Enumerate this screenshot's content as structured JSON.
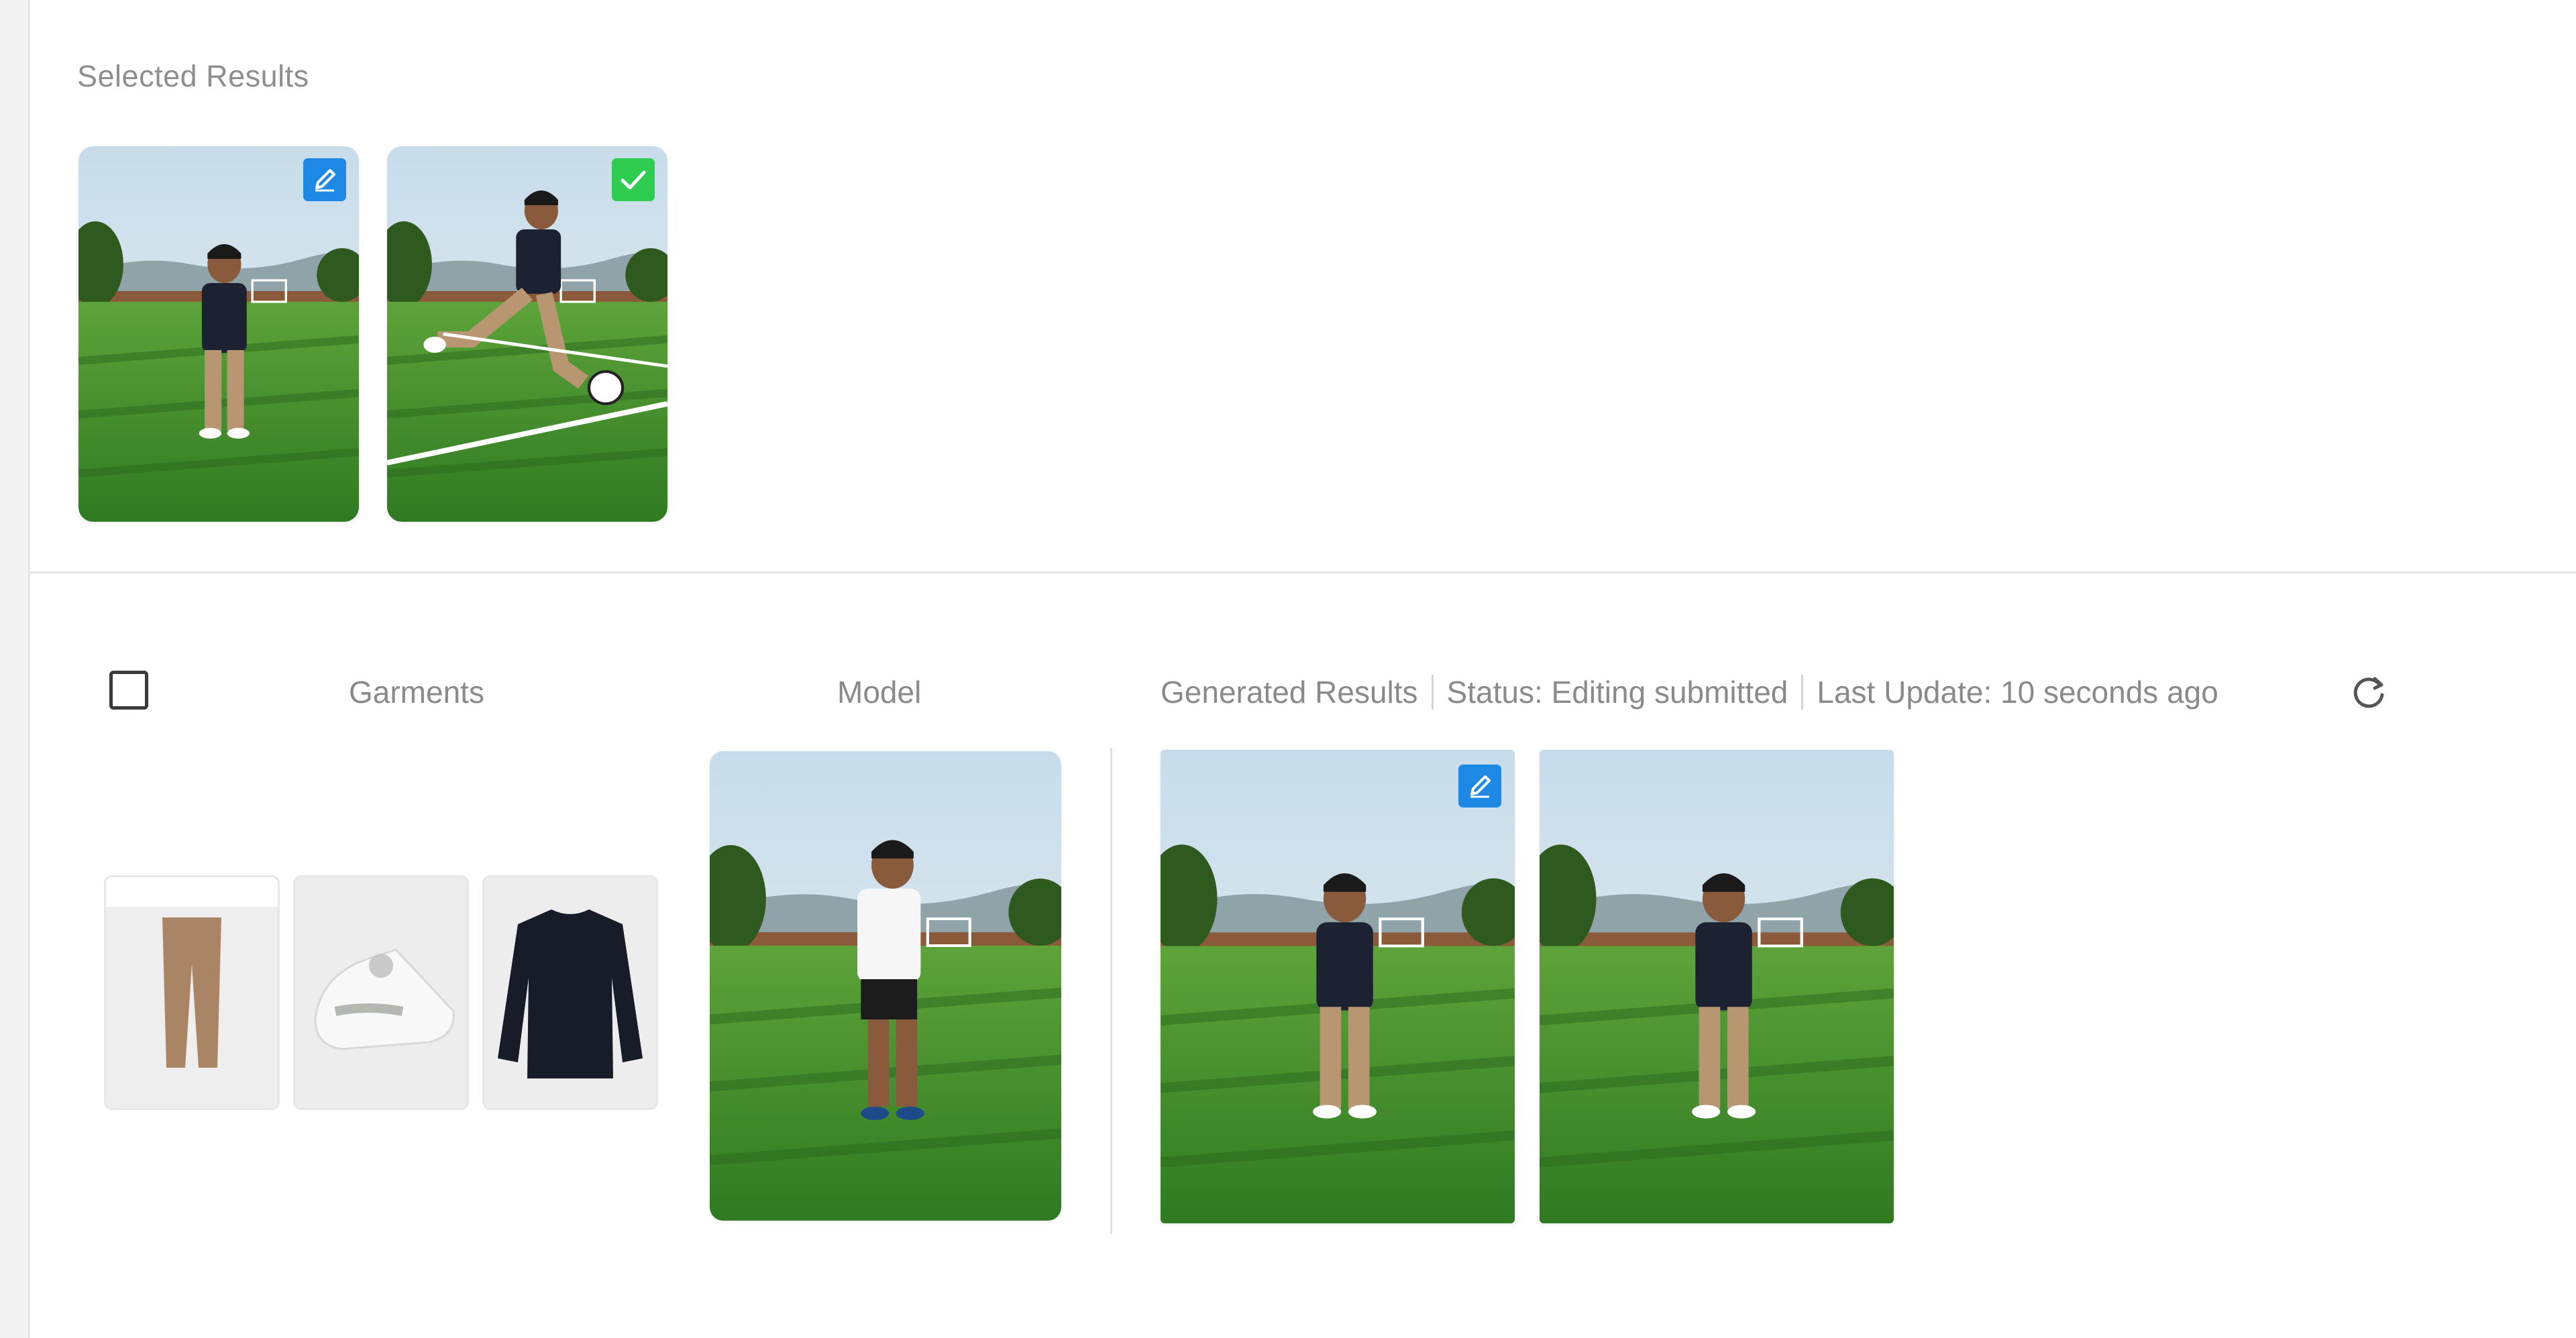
{
  "selected_results": {
    "title": "Selected Results",
    "items": [
      {
        "badge": "pencil-icon",
        "badge_color": "#1e88e5"
      },
      {
        "badge": "check-icon",
        "badge_color": "#2ecc4f"
      }
    ]
  },
  "table": {
    "headers": {
      "garments": "Garments",
      "model": "Model"
    },
    "meta": {
      "results_label": "Generated Results",
      "status": "Status: Editing submitted",
      "last_update": "Last Update: 10 seconds ago"
    },
    "garments": [
      "pants",
      "sneaker",
      "sweater"
    ],
    "generated": [
      {
        "badge": "pencil-icon",
        "badge_color": "#1e88e5"
      },
      {
        "badge": null
      }
    ]
  },
  "colors": {
    "sky": "#d8e6ef",
    "grass": "#3f8a2b",
    "accent_edit": "#1e88e5",
    "accent_ok": "#2ecc4f"
  }
}
